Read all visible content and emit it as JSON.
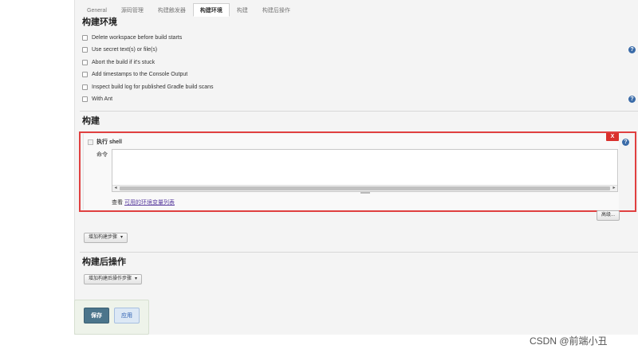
{
  "tabs": [
    "General",
    "源码管理",
    "构建触发器",
    "构建环境",
    "构建",
    "构建后操作"
  ],
  "active_tab_index": 3,
  "build_env": {
    "title": "构建环境",
    "options": [
      "Delete workspace before build starts",
      "Use secret text(s) or file(s)",
      "Abort the build if it's stuck",
      "Add timestamps to the Console Output",
      "Inspect build log for published Gradle build scans",
      "With Ant"
    ]
  },
  "build": {
    "title": "构建",
    "step_title": "执行 shell",
    "delete_label": "X",
    "command_label": "命令",
    "command_value": "",
    "env_prefix": "查看 ",
    "env_link": "可用的环境变量列表",
    "advanced_label": "高级...",
    "add_step_label": "增加构建步骤"
  },
  "post_build": {
    "title": "构建后操作",
    "add_step_label": "增加构建后操作步骤"
  },
  "actions": {
    "save_label": "保存",
    "apply_label": "应用"
  },
  "help_glyph": "?",
  "watermark": "CSDN @前端小丑",
  "colors": {
    "highlight_border": "#e04040",
    "save_button": "#4b758b",
    "help_icon": "#3a6ba8",
    "delete_button": "#d9302c"
  }
}
